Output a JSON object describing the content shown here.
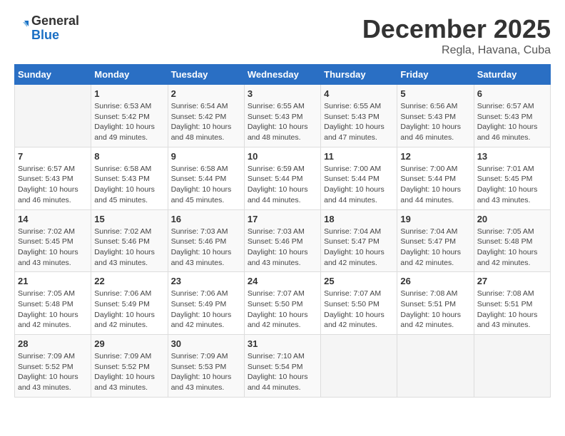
{
  "logo": {
    "line1": "General",
    "line2": "Blue"
  },
  "title": "December 2025",
  "location": "Regla, Havana, Cuba",
  "weekdays": [
    "Sunday",
    "Monday",
    "Tuesday",
    "Wednesday",
    "Thursday",
    "Friday",
    "Saturday"
  ],
  "weeks": [
    [
      {
        "day": "",
        "info": ""
      },
      {
        "day": "1",
        "info": "Sunrise: 6:53 AM\nSunset: 5:42 PM\nDaylight: 10 hours\nand 49 minutes."
      },
      {
        "day": "2",
        "info": "Sunrise: 6:54 AM\nSunset: 5:42 PM\nDaylight: 10 hours\nand 48 minutes."
      },
      {
        "day": "3",
        "info": "Sunrise: 6:55 AM\nSunset: 5:43 PM\nDaylight: 10 hours\nand 48 minutes."
      },
      {
        "day": "4",
        "info": "Sunrise: 6:55 AM\nSunset: 5:43 PM\nDaylight: 10 hours\nand 47 minutes."
      },
      {
        "day": "5",
        "info": "Sunrise: 6:56 AM\nSunset: 5:43 PM\nDaylight: 10 hours\nand 46 minutes."
      },
      {
        "day": "6",
        "info": "Sunrise: 6:57 AM\nSunset: 5:43 PM\nDaylight: 10 hours\nand 46 minutes."
      }
    ],
    [
      {
        "day": "7",
        "info": "Sunrise: 6:57 AM\nSunset: 5:43 PM\nDaylight: 10 hours\nand 46 minutes."
      },
      {
        "day": "8",
        "info": "Sunrise: 6:58 AM\nSunset: 5:43 PM\nDaylight: 10 hours\nand 45 minutes."
      },
      {
        "day": "9",
        "info": "Sunrise: 6:58 AM\nSunset: 5:44 PM\nDaylight: 10 hours\nand 45 minutes."
      },
      {
        "day": "10",
        "info": "Sunrise: 6:59 AM\nSunset: 5:44 PM\nDaylight: 10 hours\nand 44 minutes."
      },
      {
        "day": "11",
        "info": "Sunrise: 7:00 AM\nSunset: 5:44 PM\nDaylight: 10 hours\nand 44 minutes."
      },
      {
        "day": "12",
        "info": "Sunrise: 7:00 AM\nSunset: 5:44 PM\nDaylight: 10 hours\nand 44 minutes."
      },
      {
        "day": "13",
        "info": "Sunrise: 7:01 AM\nSunset: 5:45 PM\nDaylight: 10 hours\nand 43 minutes."
      }
    ],
    [
      {
        "day": "14",
        "info": "Sunrise: 7:02 AM\nSunset: 5:45 PM\nDaylight: 10 hours\nand 43 minutes."
      },
      {
        "day": "15",
        "info": "Sunrise: 7:02 AM\nSunset: 5:46 PM\nDaylight: 10 hours\nand 43 minutes."
      },
      {
        "day": "16",
        "info": "Sunrise: 7:03 AM\nSunset: 5:46 PM\nDaylight: 10 hours\nand 43 minutes."
      },
      {
        "day": "17",
        "info": "Sunrise: 7:03 AM\nSunset: 5:46 PM\nDaylight: 10 hours\nand 43 minutes."
      },
      {
        "day": "18",
        "info": "Sunrise: 7:04 AM\nSunset: 5:47 PM\nDaylight: 10 hours\nand 42 minutes."
      },
      {
        "day": "19",
        "info": "Sunrise: 7:04 AM\nSunset: 5:47 PM\nDaylight: 10 hours\nand 42 minutes."
      },
      {
        "day": "20",
        "info": "Sunrise: 7:05 AM\nSunset: 5:48 PM\nDaylight: 10 hours\nand 42 minutes."
      }
    ],
    [
      {
        "day": "21",
        "info": "Sunrise: 7:05 AM\nSunset: 5:48 PM\nDaylight: 10 hours\nand 42 minutes."
      },
      {
        "day": "22",
        "info": "Sunrise: 7:06 AM\nSunset: 5:49 PM\nDaylight: 10 hours\nand 42 minutes."
      },
      {
        "day": "23",
        "info": "Sunrise: 7:06 AM\nSunset: 5:49 PM\nDaylight: 10 hours\nand 42 minutes."
      },
      {
        "day": "24",
        "info": "Sunrise: 7:07 AM\nSunset: 5:50 PM\nDaylight: 10 hours\nand 42 minutes."
      },
      {
        "day": "25",
        "info": "Sunrise: 7:07 AM\nSunset: 5:50 PM\nDaylight: 10 hours\nand 42 minutes."
      },
      {
        "day": "26",
        "info": "Sunrise: 7:08 AM\nSunset: 5:51 PM\nDaylight: 10 hours\nand 42 minutes."
      },
      {
        "day": "27",
        "info": "Sunrise: 7:08 AM\nSunset: 5:51 PM\nDaylight: 10 hours\nand 43 minutes."
      }
    ],
    [
      {
        "day": "28",
        "info": "Sunrise: 7:09 AM\nSunset: 5:52 PM\nDaylight: 10 hours\nand 43 minutes."
      },
      {
        "day": "29",
        "info": "Sunrise: 7:09 AM\nSunset: 5:52 PM\nDaylight: 10 hours\nand 43 minutes."
      },
      {
        "day": "30",
        "info": "Sunrise: 7:09 AM\nSunset: 5:53 PM\nDaylight: 10 hours\nand 43 minutes."
      },
      {
        "day": "31",
        "info": "Sunrise: 7:10 AM\nSunset: 5:54 PM\nDaylight: 10 hours\nand 44 minutes."
      },
      {
        "day": "",
        "info": ""
      },
      {
        "day": "",
        "info": ""
      },
      {
        "day": "",
        "info": ""
      }
    ]
  ]
}
